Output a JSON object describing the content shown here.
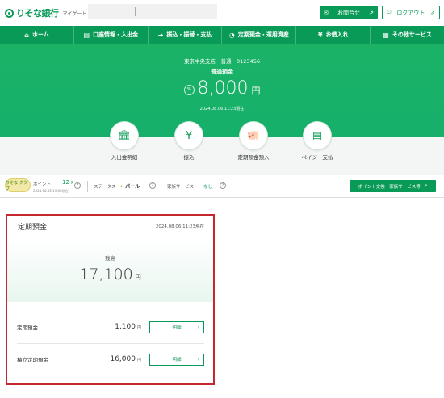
{
  "header": {
    "logo_name": "りそな銀行",
    "logo_sub": "マイゲート",
    "inquiry_label": "お問合せ",
    "logout_label": "ログアウト"
  },
  "nav": [
    {
      "icon": "home-icon",
      "glyph": "⌂",
      "label": "ホーム"
    },
    {
      "icon": "bankbook-icon",
      "glyph": "▤",
      "label": "口座情報・入出金"
    },
    {
      "icon": "transfer-icon",
      "glyph": "➜",
      "label": "振込・振替・支払"
    },
    {
      "icon": "piggybank-icon",
      "glyph": "◔",
      "label": "定期預金・運用資産"
    },
    {
      "icon": "loan-icon",
      "glyph": "¥",
      "label": "お借入れ"
    },
    {
      "icon": "grid-icon",
      "glyph": "▦",
      "label": "その他サービス"
    }
  ],
  "account": {
    "branch_line": "東京中央支店　普通　0123456",
    "type": "普通預金",
    "balance": "8,000",
    "currency": "円",
    "toggle_icon_text": "%",
    "as_of": "2024.08.06 11:23現在"
  },
  "quick_actions": [
    {
      "icon": "bank-building-icon",
      "glyph": "🏛",
      "label": "入出金明細"
    },
    {
      "icon": "yen-transfer-icon",
      "glyph": "¥",
      "label": "振込"
    },
    {
      "icon": "piggybank-icon",
      "glyph": "🐖",
      "label": "定期預金預入"
    },
    {
      "icon": "pay-easy-icon",
      "glyph": "▤",
      "label": "ペイジー支払"
    }
  ],
  "points": {
    "club_badge": "りそな クラブ",
    "label": "ポイント",
    "value": "12",
    "unit": "P",
    "date": "2024.08.05 19:00現在",
    "status_label": "ステータス",
    "status_value": "パール",
    "family_label": "家族サービス",
    "family_value": "なし",
    "exchange_button": "ポイント交換・家族サービス等",
    "help_glyph": "?"
  },
  "time_deposit": {
    "title": "定期預金",
    "as_of": "2024.08.06 11:23現在",
    "balance_label": "残高",
    "balance": "17,100",
    "currency": "円",
    "rows": [
      {
        "name": "定期預金",
        "amount": "1,100",
        "currency": "円",
        "button": "明細"
      },
      {
        "name": "積立定期預金",
        "amount": "16,000",
        "currency": "円",
        "button": "明細"
      }
    ]
  },
  "colors": {
    "brand_green": "#0a9a57",
    "highlight_red": "#c4272d"
  }
}
